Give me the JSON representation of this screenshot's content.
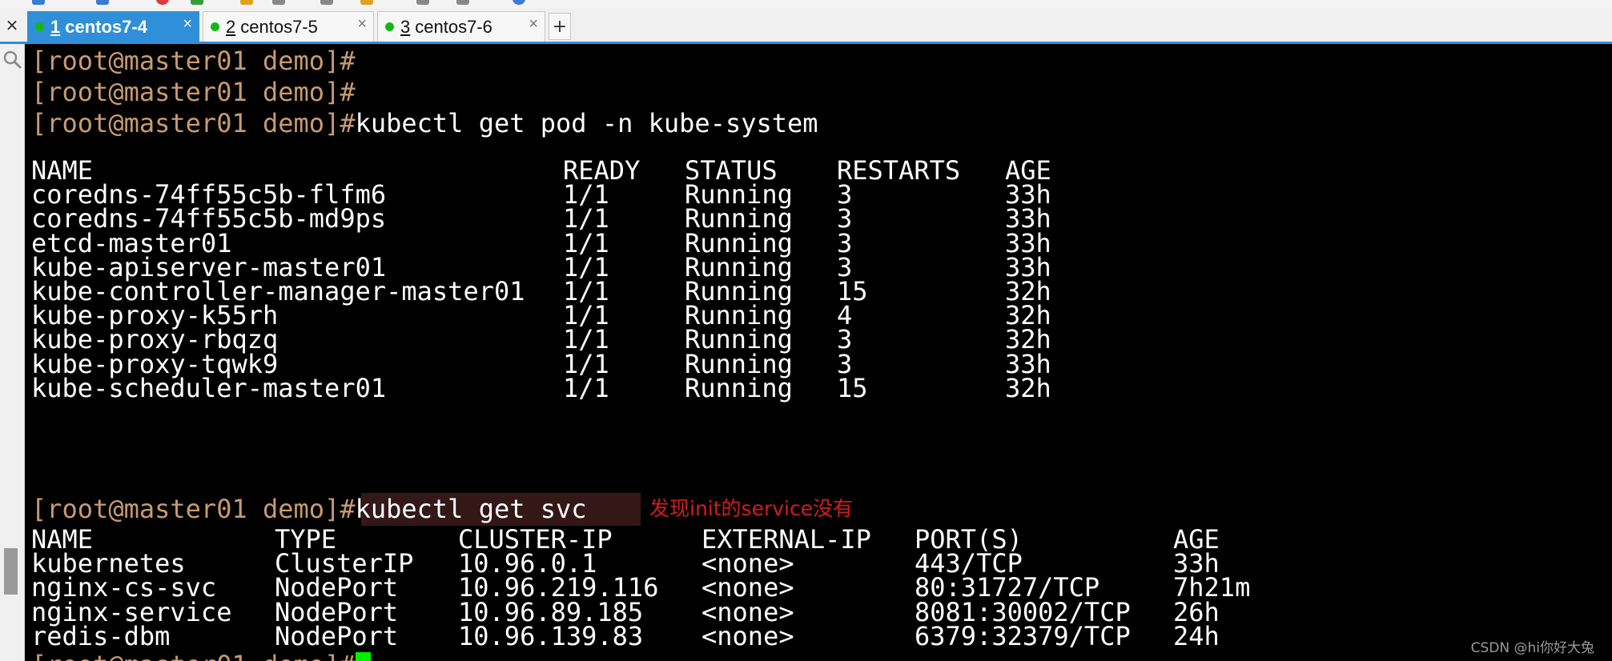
{
  "tabs": [
    {
      "num": "1",
      "label": "centos7-4",
      "active": true
    },
    {
      "num": "2",
      "label": "centos7-5",
      "active": false
    },
    {
      "num": "3",
      "label": "centos7-6",
      "active": false
    }
  ],
  "terminal": {
    "prompt": "[root@master01 demo]#",
    "commands": {
      "get_pod": "kubectl get pod -n kube-system",
      "get_svc": "kubectl get svc"
    },
    "pods": {
      "headers": [
        "NAME",
        "READY",
        "STATUS",
        "RESTARTS",
        "AGE"
      ],
      "rows": [
        [
          "coredns-74ff55c5b-flfm6",
          "1/1",
          "Running",
          "3",
          "33h"
        ],
        [
          "coredns-74ff55c5b-md9ps",
          "1/1",
          "Running",
          "3",
          "33h"
        ],
        [
          "etcd-master01",
          "1/1",
          "Running",
          "3",
          "33h"
        ],
        [
          "kube-apiserver-master01",
          "1/1",
          "Running",
          "3",
          "33h"
        ],
        [
          "kube-controller-manager-master01",
          "1/1",
          "Running",
          "15",
          "32h"
        ],
        [
          "kube-proxy-k55rh",
          "1/1",
          "Running",
          "4",
          "32h"
        ],
        [
          "kube-proxy-rbqzq",
          "1/1",
          "Running",
          "3",
          "32h"
        ],
        [
          "kube-proxy-tqwk9",
          "1/1",
          "Running",
          "3",
          "33h"
        ],
        [
          "kube-scheduler-master01",
          "1/1",
          "Running",
          "15",
          "32h"
        ]
      ]
    },
    "services": {
      "headers": [
        "NAME",
        "TYPE",
        "CLUSTER-IP",
        "EXTERNAL-IP",
        "PORT(S)",
        "AGE"
      ],
      "rows": [
        [
          "kubernetes",
          "ClusterIP",
          "10.96.0.1",
          "<none>",
          "443/TCP",
          "33h"
        ],
        [
          "nginx-cs-svc",
          "NodePort",
          "10.96.219.116",
          "<none>",
          "80:31727/TCP",
          "7h21m"
        ],
        [
          "nginx-service",
          "NodePort",
          "10.96.89.185",
          "<none>",
          "8081:30002/TCP",
          "26h"
        ],
        [
          "redis-dbm",
          "NodePort",
          "10.96.139.83",
          "<none>",
          "6379:32379/TCP",
          "24h"
        ]
      ]
    },
    "annotation": "发现init的service没有"
  },
  "watermark": "CSDN @hi你好大兔",
  "colors": {
    "prompt": "#c89b6e",
    "annotation": "#d41c1c",
    "cursor": "#00ee00",
    "tab_active": "#2f8fd8"
  }
}
